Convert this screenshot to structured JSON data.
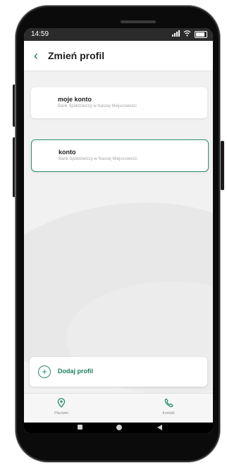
{
  "status_bar": {
    "time": "14:59"
  },
  "header": {
    "title": "Zmień profil"
  },
  "profiles": [
    {
      "name": "moje konto",
      "bank": "Bank Spółdzielczy w Naszej Miejscowości"
    },
    {
      "name": "konto",
      "bank": "Bank Spółdzielczy w Naszej Miejscowości"
    }
  ],
  "add_profile": {
    "label": "Dodaj profil"
  },
  "bottom_nav": {
    "items": [
      {
        "label": "Placówki",
        "icon": "location-pin-icon"
      },
      {
        "label": "Kontakt",
        "icon": "phone-icon"
      }
    ]
  },
  "colors": {
    "accent": "#1f8b68",
    "selected_border": "#2f8f72"
  }
}
